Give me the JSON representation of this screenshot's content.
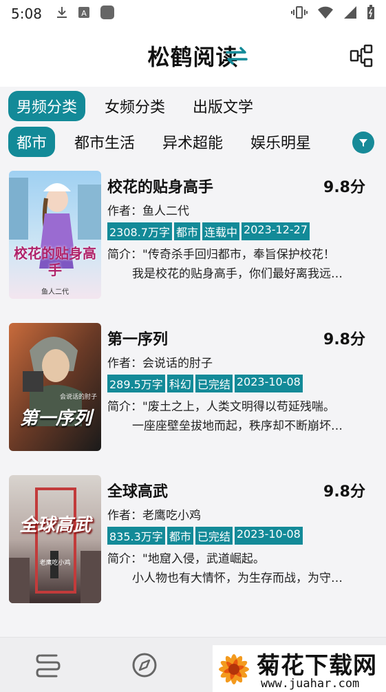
{
  "status": {
    "time": "5:08"
  },
  "header": {
    "title": "松鹤阅读"
  },
  "tabs_primary": [
    "男频分类",
    "女频分类",
    "出版文学"
  ],
  "tabs_secondary": [
    "都市",
    "都市生活",
    "异术超能",
    "娱乐明星"
  ],
  "books": [
    {
      "title": "校花的贴身高手",
      "score": "9.8分",
      "author": "作者：鱼人二代",
      "tags": [
        "2308.7万字",
        "都市",
        "连载中",
        "2023-12-27"
      ],
      "intro_line1": "简介：\"传奇杀手回归都市，奉旨保护校花！",
      "intro_line2": "我是校花的贴身高手，你们最好离我远…",
      "cover_text": "校花的贴身高手",
      "cover_author": "鱼人二代"
    },
    {
      "title": "第一序列",
      "score": "9.8分",
      "author": "作者：会说话的肘子",
      "tags": [
        "289.5万字",
        "科幻",
        "已完结",
        "2023-10-08"
      ],
      "intro_line1": "简介：\"废土之上，人类文明得以苟延残喘。",
      "intro_line2": "一座座壁垒拔地而起，秩序却不断崩坏…",
      "cover_text": "第一序列",
      "cover_author": "会说话的肘子"
    },
    {
      "title": "全球高武",
      "score": "9.8分",
      "author": "作者：老鹰吃小鸡",
      "tags": [
        "835.3万字",
        "都市",
        "已完结",
        "2023-10-08"
      ],
      "intro_line1": "简介：\"地窟入侵，武道崛起。",
      "intro_line2": "小人物也有大情怀，为生存而战，为守…",
      "cover_text": "全球高武",
      "cover_author": "老鹰吃小鸡"
    }
  ],
  "watermark": {
    "title": "菊花下载网",
    "url": "www.juahar.com"
  },
  "colors": {
    "accent": "#138a98",
    "background": "#f4f4f6"
  }
}
